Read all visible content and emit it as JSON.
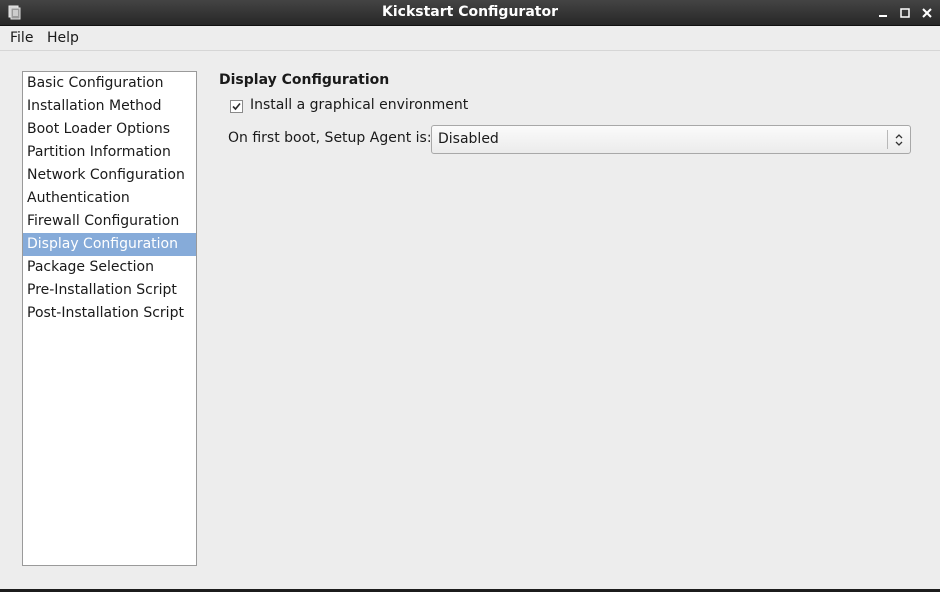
{
  "window": {
    "title": "Kickstart Configurator",
    "icons": {
      "app": "app-icon",
      "minimize": "minimize-icon",
      "maximize": "maximize-icon",
      "close": "close-icon"
    }
  },
  "menubar": {
    "file": "File",
    "help": "Help"
  },
  "sidebar": {
    "items": [
      {
        "label": "Basic Configuration"
      },
      {
        "label": "Installation Method"
      },
      {
        "label": "Boot Loader Options"
      },
      {
        "label": "Partition Information"
      },
      {
        "label": "Network Configuration"
      },
      {
        "label": "Authentication"
      },
      {
        "label": "Firewall Configuration"
      },
      {
        "label": "Display Configuration",
        "selected": true
      },
      {
        "label": "Package Selection"
      },
      {
        "label": "Pre-Installation Script"
      },
      {
        "label": "Post-Installation Script"
      }
    ],
    "selection_color": "#86abd9"
  },
  "main": {
    "section_title": "Display Configuration",
    "graphical_env": {
      "label": "Install a graphical environment",
      "checked": true
    },
    "setup_agent": {
      "label": "On first boot, Setup Agent is:",
      "value": "Disabled",
      "icon": "chevron-up-down-icon"
    }
  }
}
